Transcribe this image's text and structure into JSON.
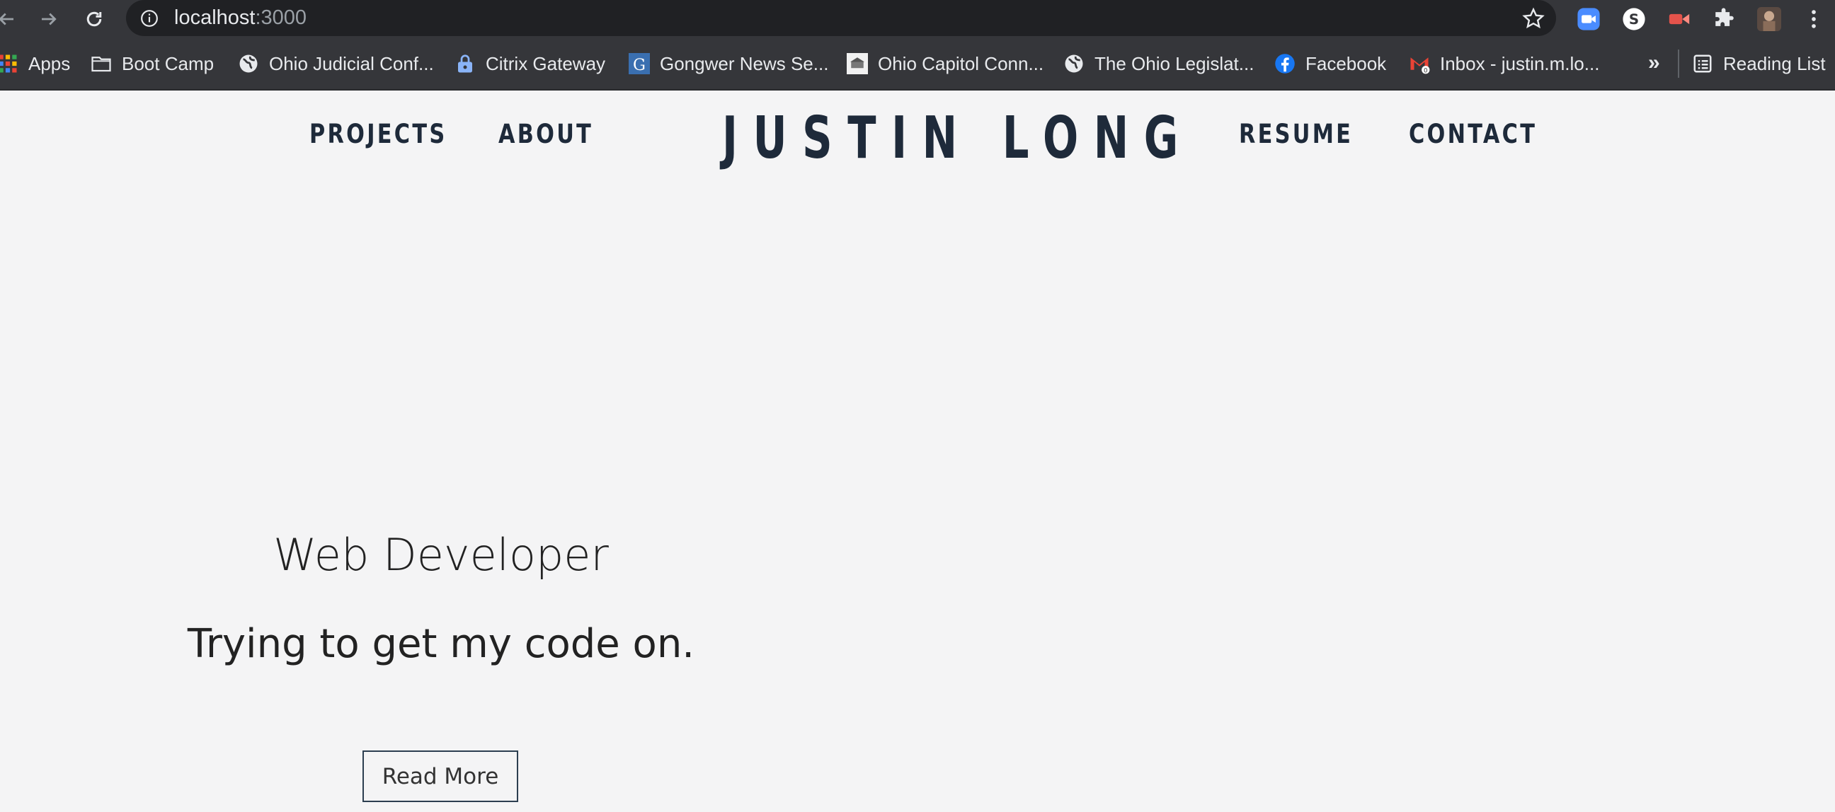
{
  "browser": {
    "url_host": "localhost",
    "url_port": ":3000",
    "bookmarks": [
      {
        "label": "Apps",
        "icon": "apps-grid-icon"
      },
      {
        "label": "Boot Camp",
        "icon": "folder-icon"
      },
      {
        "label": "Ohio Judicial Conf...",
        "icon": "globe-icon"
      },
      {
        "label": "Citrix Gateway",
        "icon": "lock-icon"
      },
      {
        "label": "Gongwer News Se...",
        "icon": "gongwer-g-icon"
      },
      {
        "label": "Ohio Capitol Conn...",
        "icon": "capitol-icon"
      },
      {
        "label": "The Ohio Legislat...",
        "icon": "globe-icon"
      },
      {
        "label": "Facebook",
        "icon": "facebook-icon"
      },
      {
        "label": "Inbox - justin.m.lo...",
        "icon": "gmail-icon"
      }
    ],
    "overflow_label": "»",
    "reading_list_label": "Reading List"
  },
  "site": {
    "nav_left": [
      "PROJECTS",
      "ABOUT"
    ],
    "logo": "JUSTIN LONG",
    "nav_right": [
      "RESUME",
      "CONTACT"
    ]
  },
  "hero": {
    "title": "Web Developer",
    "subtitle": "Trying to get my code on.",
    "button": "Read More"
  },
  "colors": {
    "chrome_bg": "#35363a",
    "omnibox_bg": "#202124",
    "page_bg": "#f4f4f5",
    "brand_navy": "#1e2a3a"
  }
}
